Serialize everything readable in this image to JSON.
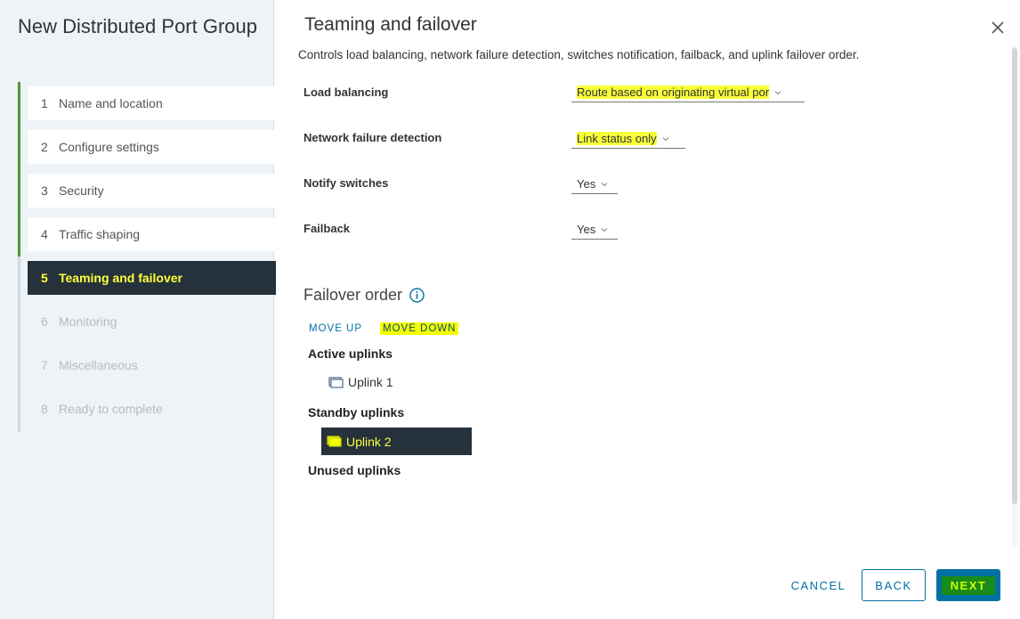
{
  "wizard": {
    "title": "New Distributed Port Group",
    "steps": [
      {
        "num": "1",
        "label": "Name and location",
        "state": "done"
      },
      {
        "num": "2",
        "label": "Configure settings",
        "state": "done"
      },
      {
        "num": "3",
        "label": "Security",
        "state": "done"
      },
      {
        "num": "4",
        "label": "Traffic shaping",
        "state": "done"
      },
      {
        "num": "5",
        "label": "Teaming and failover",
        "state": "current"
      },
      {
        "num": "6",
        "label": "Monitoring",
        "state": "future"
      },
      {
        "num": "7",
        "label": "Miscellaneous",
        "state": "future"
      },
      {
        "num": "8",
        "label": "Ready to complete",
        "state": "future"
      }
    ]
  },
  "page": {
    "title": "Teaming and failover",
    "description": "Controls load balancing, network failure detection, switches notification, failback, and uplink failover order."
  },
  "fields": {
    "load_balancing": {
      "label": "Load balancing",
      "value": "Route based on originating virtual por"
    },
    "network_failure_detection": {
      "label": "Network failure detection",
      "value": "Link status only"
    },
    "notify_switches": {
      "label": "Notify switches",
      "value": "Yes"
    },
    "failback": {
      "label": "Failback",
      "value": "Yes"
    }
  },
  "failover": {
    "title": "Failover order",
    "move_up": "MOVE UP",
    "move_down": "MOVE DOWN",
    "active_label": "Active uplinks",
    "active": [
      "Uplink 1"
    ],
    "standby_label": "Standby uplinks",
    "standby": [
      "Uplink 2"
    ],
    "unused_label": "Unused uplinks"
  },
  "buttons": {
    "cancel": "CANCEL",
    "back": "BACK",
    "next": "NEXT"
  },
  "colors": {
    "accent": "#0072a3",
    "selected_bg": "#25323c",
    "complete_bar": "#4c9a33",
    "highlight": "#f2ff00"
  }
}
